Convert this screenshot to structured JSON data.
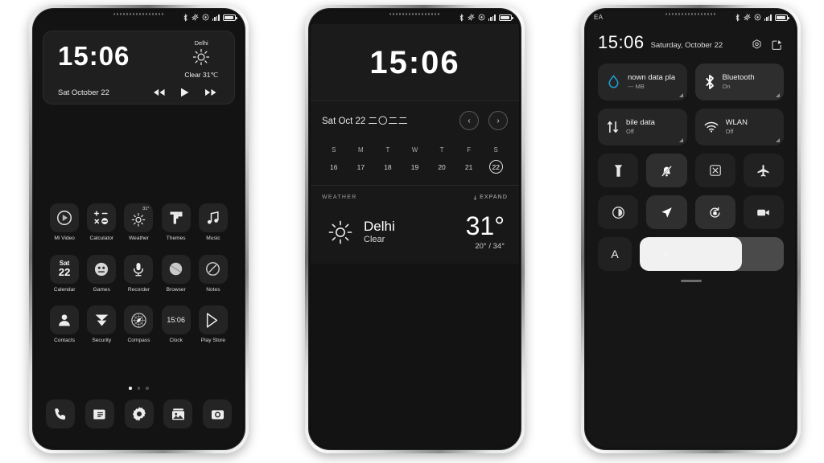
{
  "status_bar": {
    "icons": [
      "bluetooth-icon",
      "location-off-icon",
      "dnd-icon",
      "signal-bars-icon",
      "battery-icon"
    ],
    "carrier": "EA"
  },
  "phone1": {
    "name": "home-screen",
    "widget": {
      "time": "15:06",
      "city": "Delhi",
      "condition": "Clear 31℃",
      "weather_icon": "sun-icon",
      "date": "Sat October 22",
      "controls": [
        "previous-icon",
        "play-icon",
        "next-icon"
      ]
    },
    "apps": [
      {
        "label": "Mi Video",
        "icon": "play-circle-icon"
      },
      {
        "label": "Calculator",
        "icon": "calculator-icon"
      },
      {
        "label": "Weather",
        "icon": "sun-icon",
        "badge": "31°"
      },
      {
        "label": "Themes",
        "icon": "themes-icon"
      },
      {
        "label": "Music",
        "icon": "music-note-icon"
      },
      {
        "label": "Calendar",
        "icon": "calendar-icon",
        "day": "Sat",
        "date": "22"
      },
      {
        "label": "Games",
        "icon": "games-face-icon"
      },
      {
        "label": "Recorder",
        "icon": "microphone-icon"
      },
      {
        "label": "Browser",
        "icon": "browser-circle-icon"
      },
      {
        "label": "Notes",
        "icon": "notes-circle-icon"
      },
      {
        "label": "Contacts",
        "icon": "person-icon"
      },
      {
        "label": "Security",
        "icon": "shield-icon"
      },
      {
        "label": "Compass",
        "icon": "compass-icon"
      },
      {
        "label": "Clock",
        "icon": "clock-icon",
        "time": "15:06"
      },
      {
        "label": "Play Store",
        "icon": "play-store-icon"
      }
    ],
    "page_dots": {
      "count": 3,
      "active": 1
    },
    "dock": [
      {
        "icon": "phone-icon",
        "label": "Phone"
      },
      {
        "icon": "messages-icon",
        "label": "Messages"
      },
      {
        "icon": "settings-gear-icon",
        "label": "Settings"
      },
      {
        "icon": "gallery-icon",
        "label": "Gallery"
      },
      {
        "icon": "camera-icon",
        "label": "Camera"
      }
    ]
  },
  "phone2": {
    "name": "app-vault-panel",
    "time": "15:06",
    "date_label": "Sat Oct 22",
    "date_year_cn": "二〇二二",
    "nav_prev": "‹",
    "nav_next": "›",
    "week": {
      "day_initials": [
        "S",
        "M",
        "T",
        "W",
        "T",
        "F",
        "S"
      ],
      "dates": [
        "16",
        "17",
        "18",
        "19",
        "20",
        "21",
        "22"
      ],
      "today": "22"
    },
    "weather_card": {
      "title": "WEATHER",
      "expand": "EXPAND",
      "expand_icon": "chevron-down-icon",
      "icon": "sun-icon",
      "city": "Delhi",
      "condition": "Clear",
      "temperature": "31°",
      "range": "20° / 34°"
    }
  },
  "phone3": {
    "name": "control-center",
    "carrier": "EA",
    "time": "15:06",
    "date": "Saturday, October 22",
    "header_buttons": [
      {
        "icon": "settings-gear-icon",
        "label": "Settings"
      },
      {
        "icon": "edit-icon",
        "label": "Edit"
      }
    ],
    "big_tiles": [
      {
        "title": "nown data pla",
        "sub": "--- MB",
        "icon": "data-drop-icon",
        "state": "off",
        "accent": "#1f9fd8"
      },
      {
        "title": "Bluetooth",
        "sub": "On",
        "icon": "bluetooth-icon",
        "state": "on"
      },
      {
        "title": "bile data",
        "sub": "Off",
        "icon": "mobile-data-icon",
        "state": "off"
      },
      {
        "title": "WLAN",
        "sub": "Off",
        "icon": "wifi-icon",
        "state": "off"
      }
    ],
    "small_tiles": [
      {
        "icon": "flashlight-icon",
        "label": "Flashlight",
        "state": "off"
      },
      {
        "icon": "silent-bell-icon",
        "label": "Silent",
        "state": "on"
      },
      {
        "icon": "screenshot-icon",
        "label": "Screenshot",
        "state": "off"
      },
      {
        "icon": "airplane-icon",
        "label": "Airplane mode",
        "state": "off"
      },
      {
        "icon": "dark-mode-icon",
        "label": "Dark mode",
        "state": "off"
      },
      {
        "icon": "location-icon",
        "label": "Location",
        "state": "on"
      },
      {
        "icon": "rotation-lock-icon",
        "label": "Auto rotate",
        "state": "on"
      },
      {
        "icon": "screen-record-icon",
        "label": "Screen recorder",
        "state": "off"
      }
    ],
    "brightness": {
      "auto_label": "A",
      "auto_icon": "auto-brightness-icon",
      "level_percent": 71,
      "sun_icon": "sun-small-icon"
    },
    "drag_handle": "drag-handle"
  }
}
